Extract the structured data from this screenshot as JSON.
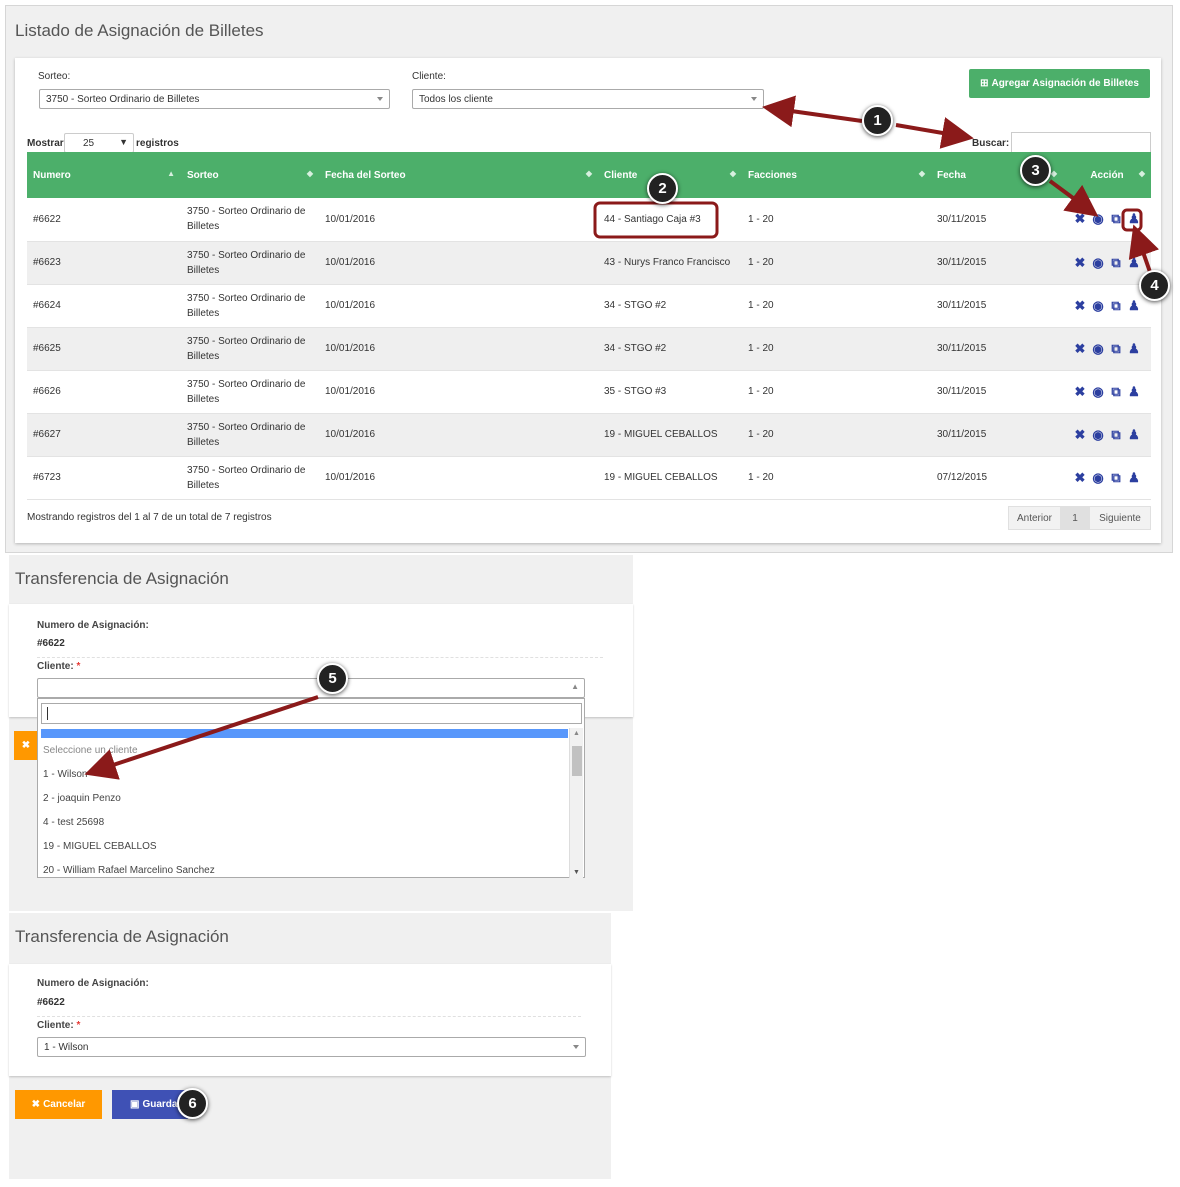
{
  "list": {
    "title": "Listado de Asignación de Billetes",
    "sorteo_label": "Sorteo:",
    "sorteo_value": "3750 - Sorteo Ordinario de Billetes",
    "cliente_label": "Cliente:",
    "cliente_value": "Todos los cliente",
    "add_button": "Agregar Asignación de Billetes",
    "mostrar": "Mostrar",
    "page_size": "25",
    "registros": "registros",
    "buscar": "Buscar:",
    "columns": [
      "Numero",
      "Sorteo",
      "Fecha del Sorteo",
      "Cliente",
      "Facciones",
      "Fecha",
      "Acción"
    ],
    "rows": [
      {
        "numero": "#6622",
        "sorteo1": "3750 - Sorteo Ordinario de",
        "sorteo2": "Billetes",
        "fecha_sorteo": "10/01/2016",
        "cliente": "44 - Santiago Caja #3",
        "facciones": "1 - 20",
        "fecha": "30/11/2015"
      },
      {
        "numero": "#6623",
        "sorteo1": "3750 - Sorteo Ordinario de",
        "sorteo2": "Billetes",
        "fecha_sorteo": "10/01/2016",
        "cliente": "43 - Nurys Franco Francisco",
        "facciones": "1 - 20",
        "fecha": "30/11/2015"
      },
      {
        "numero": "#6624",
        "sorteo1": "3750 - Sorteo Ordinario de",
        "sorteo2": "Billetes",
        "fecha_sorteo": "10/01/2016",
        "cliente": "34 - STGO #2",
        "facciones": "1 - 20",
        "fecha": "30/11/2015"
      },
      {
        "numero": "#6625",
        "sorteo1": "3750 - Sorteo Ordinario de",
        "sorteo2": "Billetes",
        "fecha_sorteo": "10/01/2016",
        "cliente": "34 - STGO #2",
        "facciones": "1 - 20",
        "fecha": "30/11/2015"
      },
      {
        "numero": "#6626",
        "sorteo1": "3750 - Sorteo Ordinario de",
        "sorteo2": "Billetes",
        "fecha_sorteo": "10/01/2016",
        "cliente": "35 - STGO #3",
        "facciones": "1 - 20",
        "fecha": "30/11/2015"
      },
      {
        "numero": "#6627",
        "sorteo1": "3750 - Sorteo Ordinario de",
        "sorteo2": "Billetes",
        "fecha_sorteo": "10/01/2016",
        "cliente": "19 - MIGUEL CEBALLOS",
        "facciones": "1 - 20",
        "fecha": "30/11/2015"
      },
      {
        "numero": "#6723",
        "sorteo1": "3750 - Sorteo Ordinario de",
        "sorteo2": "Billetes",
        "fecha_sorteo": "10/01/2016",
        "cliente": "19 - MIGUEL CEBALLOS",
        "facciones": "1 - 20",
        "fecha": "07/12/2015"
      }
    ],
    "footer_info": "Mostrando registros del 1 al 7 de un total de 7 registros",
    "prev": "Anterior",
    "page": "1",
    "next": "Siguiente"
  },
  "transfer1": {
    "title": "Transferencia de Asignación",
    "numero_label": "Numero de Asignación:",
    "numero_value": "#6622",
    "cliente_label": "Cliente:",
    "required": "*",
    "options": [
      "Seleccione un cliente",
      "1 - Wilson",
      "2 - joaquin Penzo",
      "4 - test 25698",
      "19 - MIGUEL CEBALLOS",
      "20 - William Rafael Marcelino Sanchez"
    ]
  },
  "transfer2": {
    "title": "Transferencia de Asignación",
    "numero_label": "Numero de Asignación:",
    "numero_value": "#6622",
    "cliente_label": "Cliente:",
    "required": "*",
    "cliente_value": "1 - Wilson",
    "cancel": "Cancelar",
    "save": "Guardar"
  },
  "callouts": [
    "1",
    "2",
    "3",
    "4",
    "5",
    "6"
  ],
  "colors": {
    "green": "#4caf6a",
    "orange": "#ff9800",
    "blue": "#3f51b5",
    "arrow": "#8b1a1a",
    "icon": "#2c3fa0"
  }
}
